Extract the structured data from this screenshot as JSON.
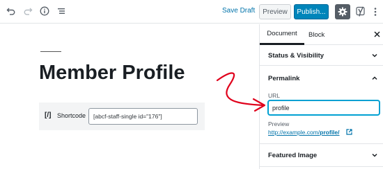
{
  "toolbar": {
    "icons": [
      "undo-icon",
      "redo-icon",
      "info-icon",
      "block-navigation-icon",
      "settings-gear-icon",
      "yoast-icon",
      "more-vertical-icon"
    ],
    "save_draft": "Save Draft",
    "preview": "Preview",
    "publish": "Publish..."
  },
  "editor": {
    "title": "Member Profile",
    "shortcode_block": {
      "icon_text": "[/]",
      "label": "Shortcode",
      "value": "[abcf-staff-single id=\"176\"]"
    }
  },
  "sidebar": {
    "tabs": [
      {
        "label": "Document",
        "active": true
      },
      {
        "label": "Block",
        "active": false
      }
    ],
    "panels": {
      "status_visibility": "Status & Visibility",
      "permalink": "Permalink",
      "featured_image": "Featured Image"
    },
    "permalink": {
      "url_label": "URL",
      "url_value": "profile",
      "preview_label": "Preview",
      "preview_link_prefix": "http://example.com/",
      "preview_link_slug": "profile/"
    }
  },
  "colors": {
    "accent": "#0085ba",
    "link": "#0073aa",
    "annotation_arrow": "#e0001b"
  }
}
